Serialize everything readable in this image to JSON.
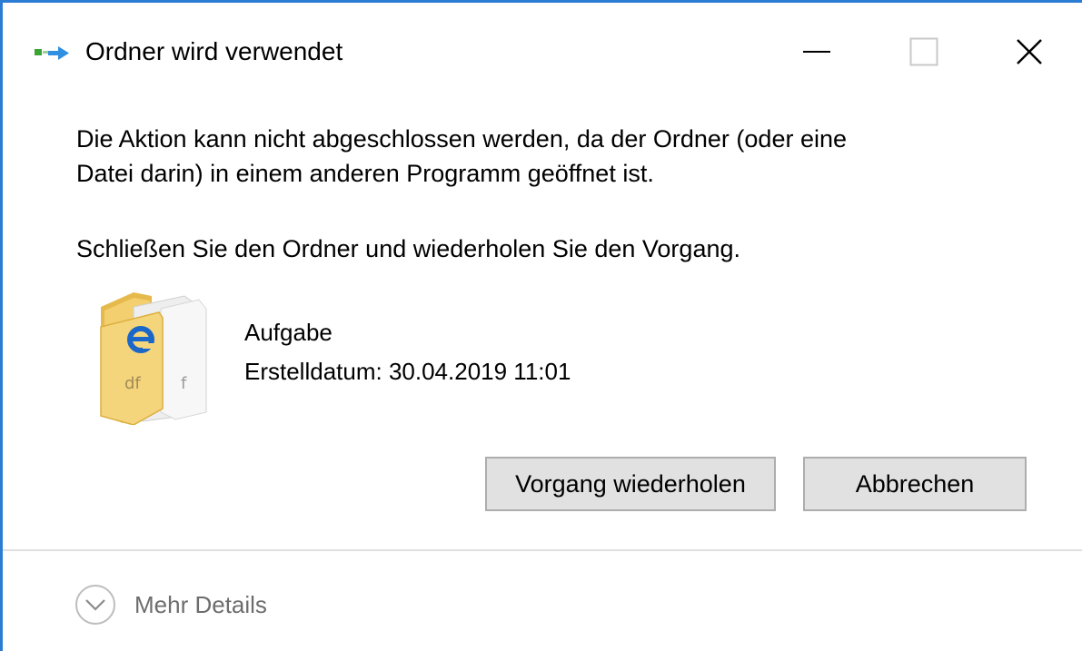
{
  "window": {
    "title": "Ordner wird verwendet",
    "controls": {
      "minimize": "minimize",
      "maximize": "maximize",
      "close": "close"
    }
  },
  "message": {
    "line1": "Die Aktion kann nicht abgeschlossen werden, da der Ordner (oder eine",
    "line2": "Datei darin) in einem anderen Programm geöffnet ist.",
    "instruction": "Schließen Sie den Ordner und wiederholen Sie den Vorgang."
  },
  "file": {
    "icon": "folder-icon",
    "name": "Aufgabe",
    "created": "Erstelldatum: 30.04.2019 11:01"
  },
  "buttons": {
    "retry": "Vorgang wiederholen",
    "cancel": "Abbrechen"
  },
  "details": {
    "label": "Mehr Details",
    "icon": "chevron-down-circle-icon"
  },
  "colors": {
    "window_border": "#2b7cd3",
    "button_bg": "#e1e1e1",
    "button_border": "#adadad",
    "details_text": "#6d6d6d"
  }
}
